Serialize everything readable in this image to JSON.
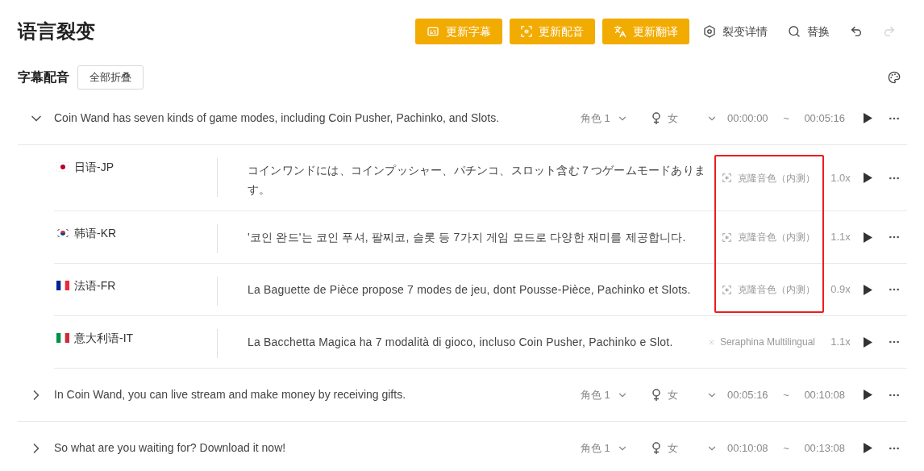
{
  "page_title": "语言裂变",
  "toolbar": [
    {
      "kind": "subtitles",
      "label": "更新字幕",
      "disabled": false
    },
    {
      "kind": "dubbing",
      "label": "更新配音",
      "disabled": false
    },
    {
      "kind": "translate",
      "label": "更新翻译",
      "disabled": false
    },
    {
      "kind": "details",
      "label": "裂变详情",
      "disabled": false
    },
    {
      "kind": "replace",
      "label": "替换",
      "disabled": false
    },
    {
      "kind": "undo",
      "disabled": false
    },
    {
      "kind": "redo",
      "disabled": true
    }
  ],
  "section": {
    "title": "字幕配音",
    "collapse_button": "全部折叠"
  },
  "segments": [
    {
      "text": "Coin Wand has seven kinds of game modes, including Coin Pusher, Pachinko, and Slots.",
      "expanded": true,
      "role": "角色 1",
      "gender": "女",
      "start": "00:00:00",
      "separator": "~",
      "end": "00:05:16",
      "translations": [
        {
          "kind": "jp",
          "language": "日语-JP",
          "text": "コインワンドには、コインプッシャー、パチンコ、スロット含む７つゲームモードあります。",
          "voice": "克隆音色（内测）",
          "speed": "1.0x",
          "annotated": true
        },
        {
          "kind": "kr",
          "language": "韩语-KR",
          "text": "'코인 완드'는 코인 푸셔, 팔찌코, 슬롯 등 7가지 게임 모드로 다양한 재미를 제공합니다.",
          "voice": "克隆音色（内测）",
          "speed": "1.1x",
          "annotated": true
        },
        {
          "kind": "fr",
          "language": "法语-FR",
          "text": "La Baguette de Pièce propose 7 modes de jeu, dont Pousse-Pièce, Pachinko et Slots.",
          "voice": "克隆音色（内测）",
          "speed": "0.9x",
          "annotated": true
        },
        {
          "kind": "it",
          "language": "意大利语-IT",
          "text": "La Bacchetta Magica ha 7 modalità di gioco, incluso Coin Pusher, Pachinko e Slot.",
          "voice": "Seraphina Multilingual",
          "speed": "1.1x",
          "annotated": false
        }
      ]
    },
    {
      "text": "In Coin Wand, you can live stream and make money by receiving gifts.",
      "expanded": false,
      "role": "角色 1",
      "gender": "女",
      "start": "00:05:16",
      "separator": "~",
      "end": "00:10:08"
    },
    {
      "text": "So what are you waiting for? Download it now!",
      "expanded": false,
      "role": "角色 1",
      "gender": "女",
      "start": "00:10:08",
      "separator": "~",
      "end": "00:13:08"
    }
  ]
}
